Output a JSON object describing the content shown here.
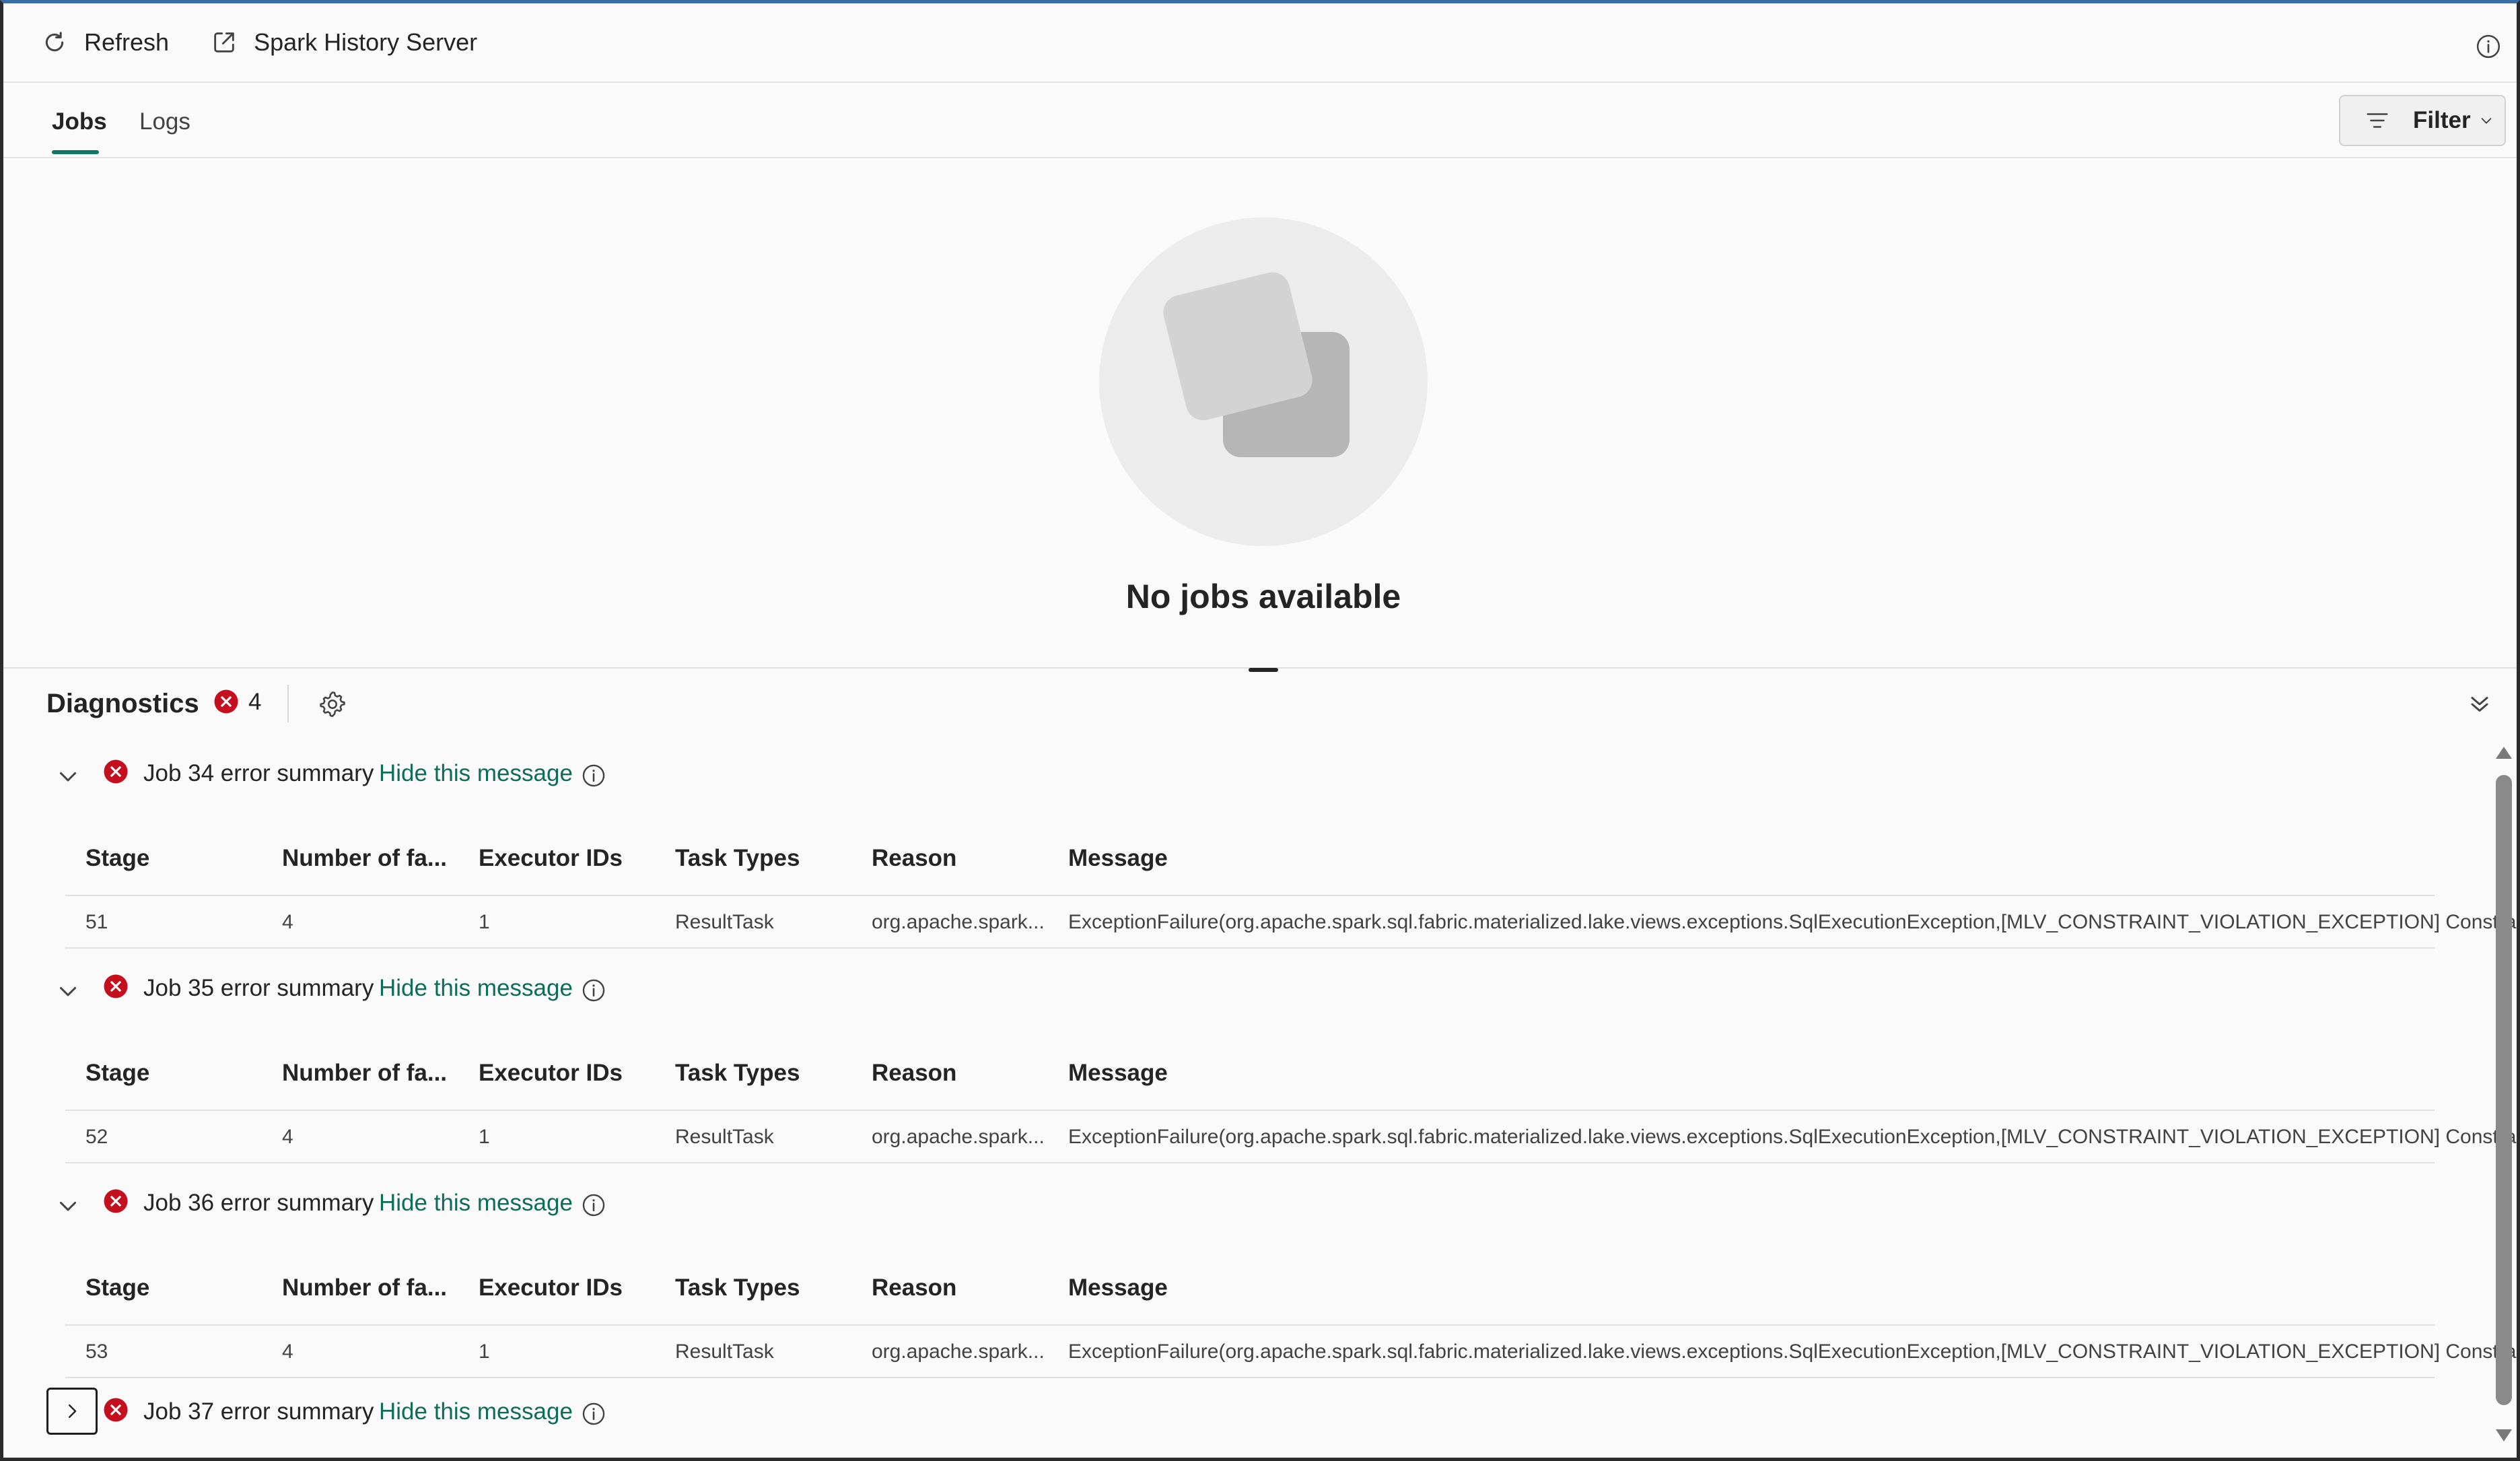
{
  "toolbar": {
    "refresh_label": "Refresh",
    "history_label": "Spark History Server"
  },
  "tabs": [
    {
      "label": "Jobs",
      "active": true
    },
    {
      "label": "Logs",
      "active": false
    }
  ],
  "filter": {
    "label": "Filter"
  },
  "empty_state": {
    "title": "No jobs available"
  },
  "diagnostics": {
    "title": "Diagnostics",
    "error_count": "4",
    "hide_label": "Hide this message",
    "columns": [
      "Stage",
      "Number of fa...",
      "Executor IDs",
      "Task Types",
      "Reason",
      "Message"
    ],
    "groups": [
      {
        "title": "Job 34 error summary",
        "expanded": true,
        "row": [
          "51",
          "4",
          "1",
          "ResultTask",
          "org.apache.spark...",
          "ExceptionFailure(org.apache.spark.sql.fabric.materialized.lake.views.exceptions.SqlExecutionException,[MLV_CONSTRAINT_VIOLATION_EXCEPTION] Constra..."
        ]
      },
      {
        "title": "Job 35 error summary",
        "expanded": true,
        "row": [
          "52",
          "4",
          "1",
          "ResultTask",
          "org.apache.spark...",
          "ExceptionFailure(org.apache.spark.sql.fabric.materialized.lake.views.exceptions.SqlExecutionException,[MLV_CONSTRAINT_VIOLATION_EXCEPTION] Constra..."
        ]
      },
      {
        "title": "Job 36 error summary",
        "expanded": true,
        "row": [
          "53",
          "4",
          "1",
          "ResultTask",
          "org.apache.spark...",
          "ExceptionFailure(org.apache.spark.sql.fabric.materialized.lake.views.exceptions.SqlExecutionException,[MLV_CONSTRAINT_VIOLATION_EXCEPTION] Constra..."
        ]
      },
      {
        "title": "Job 37 error summary",
        "expanded": false
      }
    ]
  },
  "colors": {
    "accent": "#117865",
    "link": "#0f6b5a",
    "error": "#c50f1f"
  }
}
